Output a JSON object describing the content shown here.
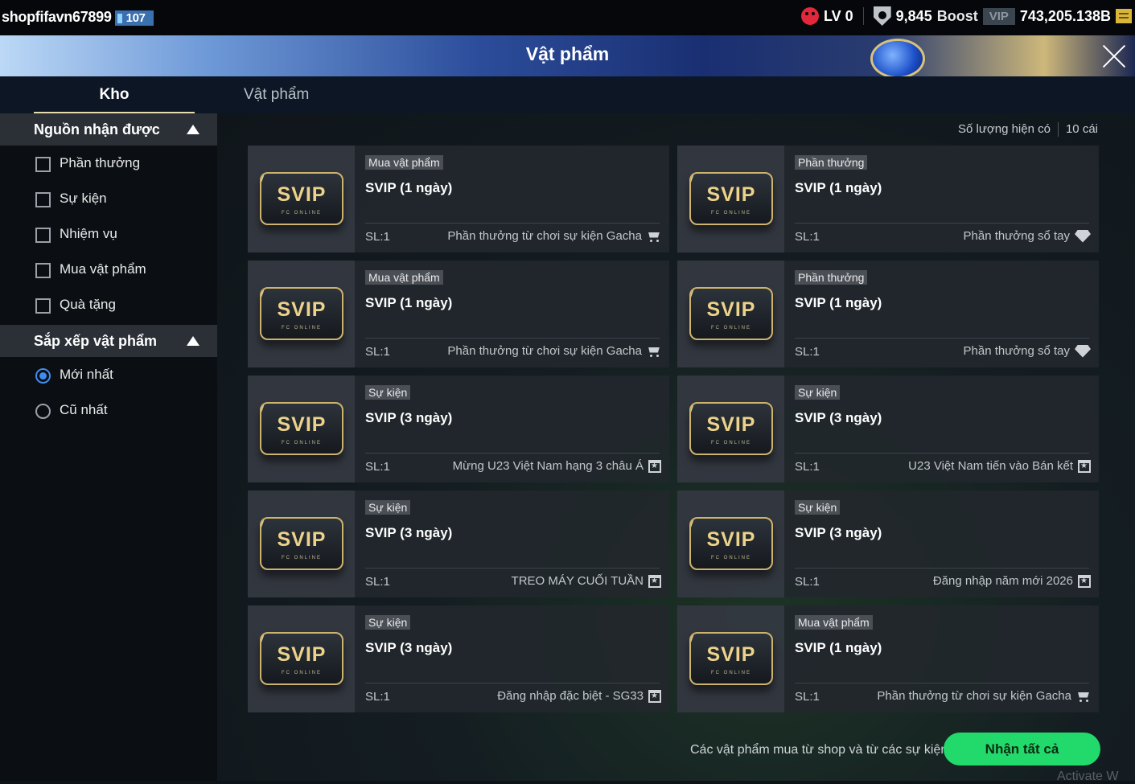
{
  "topbar": {
    "username": "shopfifavn67899",
    "user_level": "107",
    "lv": "LV 0",
    "points": "9,845",
    "boost": "Boost",
    "vip": "VIP",
    "balance": "743,205.138B"
  },
  "header": {
    "title": "Vật phẩm"
  },
  "tabs": [
    {
      "label": "Kho",
      "active": true
    },
    {
      "label": "Vật phẩm",
      "active": false
    }
  ],
  "sidebar": {
    "source_title": "Nguồn nhận được",
    "source_options": [
      {
        "label": "Phần thưởng",
        "checked": false
      },
      {
        "label": "Sự kiện",
        "checked": false
      },
      {
        "label": "Nhiệm vụ",
        "checked": false
      },
      {
        "label": "Mua vật phẩm",
        "checked": false
      },
      {
        "label": "Quà tặng",
        "checked": false
      }
    ],
    "sort_title": "Sắp xếp vật phẩm",
    "sort_options": [
      {
        "label": "Mới nhất",
        "selected": true
      },
      {
        "label": "Cũ nhất",
        "selected": false
      }
    ]
  },
  "main": {
    "count_label": "Số lượng hiện có",
    "count_value": "10 cái",
    "svip_text": "SVIP",
    "svip_sub": "FC ONLINE",
    "items": [
      {
        "tag": "Mua vật phẩm",
        "name": "SVIP (1 ngày)",
        "qty": "SL:1",
        "source": "Phần thưởng từ chơi sự kiện Gacha",
        "icon": "cart-icon"
      },
      {
        "tag": "Phần thưởng",
        "name": "SVIP (1 ngày)",
        "qty": "SL:1",
        "source": "Phần thưởng sổ tay",
        "icon": "diamond-icon"
      },
      {
        "tag": "Mua vật phẩm",
        "name": "SVIP (1 ngày)",
        "qty": "SL:1",
        "source": "Phần thưởng từ chơi sự kiện Gacha",
        "icon": "cart-icon"
      },
      {
        "tag": "Phần thưởng",
        "name": "SVIP (1 ngày)",
        "qty": "SL:1",
        "source": "Phần thưởng sổ tay",
        "icon": "diamond-icon"
      },
      {
        "tag": "Sự kiện",
        "name": "SVIP (3 ngày)",
        "qty": "SL:1",
        "source": "Mừng U23 Việt Nam hạng 3 châu Á",
        "icon": "calendar-icon"
      },
      {
        "tag": "Sự kiện",
        "name": "SVIP (3 ngày)",
        "qty": "SL:1",
        "source": "U23 Việt Nam tiến vào Bán kết",
        "icon": "calendar-icon"
      },
      {
        "tag": "Sự kiện",
        "name": "SVIP (3 ngày)",
        "qty": "SL:1",
        "source": "TREO MÁY CUỐI TUẦN",
        "icon": "calendar-icon"
      },
      {
        "tag": "Sự kiện",
        "name": "SVIP (3 ngày)",
        "qty": "SL:1",
        "source": "Đăng nhập năm mới 2026",
        "icon": "calendar-icon"
      },
      {
        "tag": "Sự kiện",
        "name": "SVIP (3 ngày)",
        "qty": "SL:1",
        "source": "Đăng nhập đặc biệt - SG33",
        "icon": "calendar-icon"
      },
      {
        "tag": "Mua vật phẩm",
        "name": "SVIP (1 ngày)",
        "qty": "SL:1",
        "source": "Phần thưởng từ chơi sự kiện Gacha",
        "icon": "cart-icon"
      }
    ],
    "footer_note": "Các vật phẩm mua từ shop và từ các sự kiện.",
    "claim_all": "Nhận tất cả"
  },
  "watermark": "Activate W",
  "colors": {
    "accent_green": "#22d96b",
    "tab_underline": "#e9dcae",
    "radio_blue": "#3f8cf0"
  }
}
